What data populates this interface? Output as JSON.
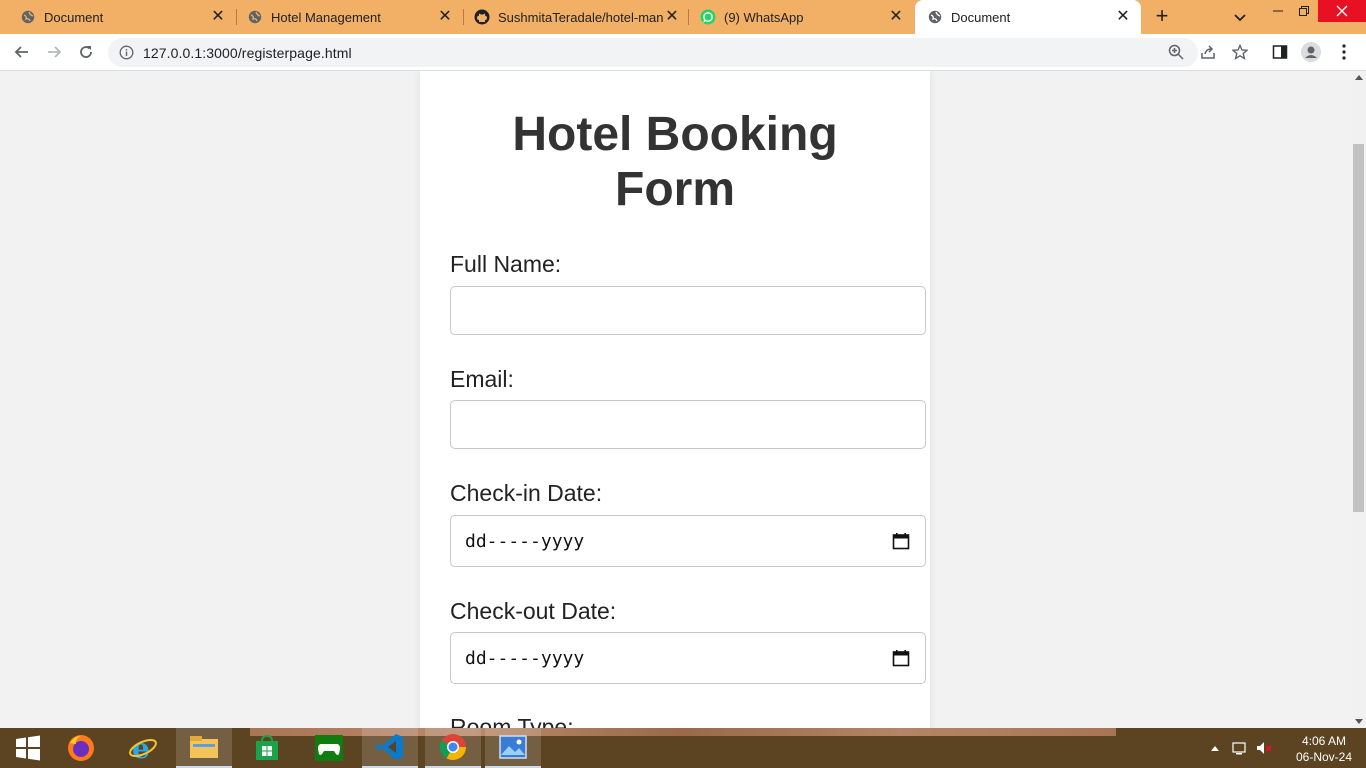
{
  "browser": {
    "tabs": [
      {
        "title": "Document",
        "icon": "globe-icon",
        "active": false
      },
      {
        "title": "Hotel Management",
        "icon": "globe-icon",
        "active": false
      },
      {
        "title": "SushmitaTeradale/hotel-mana",
        "icon": "github-icon",
        "active": false
      },
      {
        "title": "(9) WhatsApp",
        "icon": "whatsapp-icon",
        "active": false
      },
      {
        "title": "Document",
        "icon": "globe-icon",
        "active": true
      }
    ],
    "address_bar": {
      "url": "127.0.0.1:3000/registerpage.html"
    }
  },
  "form": {
    "heading_line1": "Hotel Booking",
    "heading_line2": "Form",
    "full_name_label": "Full Name:",
    "full_name_value": "",
    "email_label": "Email:",
    "email_value": "",
    "checkin_label": "Check-in Date:",
    "checkin_placeholder": "dd-----yyyy",
    "checkout_label": "Check-out Date:",
    "checkout_placeholder": "dd-----yyyy",
    "room_type_label": "Room Type:"
  },
  "taskbar": {
    "apps": [
      "start-icon",
      "firefox-icon",
      "internet-explorer-icon",
      "file-explorer-icon",
      "store-icon",
      "xbox-icon",
      "vscode-icon",
      "chrome-icon",
      "photos-icon"
    ],
    "clock_time": "4:06 AM",
    "clock_date": "06-Nov-24"
  },
  "colors": {
    "tabstrip": "#f2b066",
    "taskbar": "#5c4322",
    "heading": "#333333"
  }
}
